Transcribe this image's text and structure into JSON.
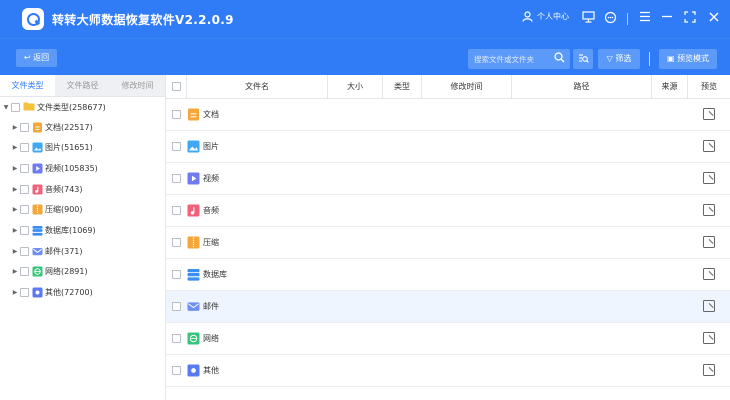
{
  "app": {
    "title": "转转大师数据恢复软件V2.2.0.9"
  },
  "titlebar": {
    "user_label": "个人中心"
  },
  "toolbar": {
    "back_label": "返回",
    "search_placeholder": "搜索文件或文件夹",
    "filter_label": "筛选",
    "preview_mode_label": "预览模式"
  },
  "left_tabs": [
    {
      "label": "文件类型",
      "active": true
    },
    {
      "label": "文件路径",
      "active": false
    },
    {
      "label": "修改时间",
      "active": false
    }
  ],
  "tree": {
    "root": {
      "label": "文件类型(258677)"
    },
    "items": [
      {
        "label": "文档(22517)",
        "icon": "document-icon",
        "color": "#f5a63a"
      },
      {
        "label": "图片(51651)",
        "icon": "image-icon",
        "color": "#3ea8f5"
      },
      {
        "label": "视频(105835)",
        "icon": "video-icon",
        "color": "#6f7cf0"
      },
      {
        "label": "音频(743)",
        "icon": "audio-icon",
        "color": "#f0627a"
      },
      {
        "label": "压缩(900)",
        "icon": "archive-icon",
        "color": "#f5a63a"
      },
      {
        "label": "数据库(1069)",
        "icon": "database-icon",
        "color": "#3a8ef5"
      },
      {
        "label": "邮件(371)",
        "icon": "mail-icon",
        "color": "#6f90f0"
      },
      {
        "label": "网络(2891)",
        "icon": "network-icon",
        "color": "#35c47a"
      },
      {
        "label": "其他(72700)",
        "icon": "other-icon",
        "color": "#5a7af0"
      }
    ]
  },
  "table": {
    "headers": [
      "文件名",
      "大小",
      "类型",
      "修改时间",
      "路径",
      "来源",
      "预览"
    ],
    "rows": [
      {
        "name": "文档",
        "icon": "document-icon",
        "color": "#f5a63a"
      },
      {
        "name": "图片",
        "icon": "image-icon",
        "color": "#3ea8f5"
      },
      {
        "name": "视频",
        "icon": "video-icon",
        "color": "#6f7cf0"
      },
      {
        "name": "音频",
        "icon": "audio-icon",
        "color": "#f0627a"
      },
      {
        "name": "压缩",
        "icon": "archive-icon",
        "color": "#f5a63a"
      },
      {
        "name": "数据库",
        "icon": "database-icon",
        "color": "#3a8ef5"
      },
      {
        "name": "邮件",
        "icon": "mail-icon",
        "color": "#6f90f0",
        "highlighted": true
      },
      {
        "name": "网络",
        "icon": "network-icon",
        "color": "#35c47a"
      },
      {
        "name": "其他",
        "icon": "other-icon",
        "color": "#5a7af0"
      }
    ]
  },
  "colors": {
    "accent": "#2f7cf6",
    "button": "#5b9af8",
    "row_highlight": "#eef5ff"
  }
}
